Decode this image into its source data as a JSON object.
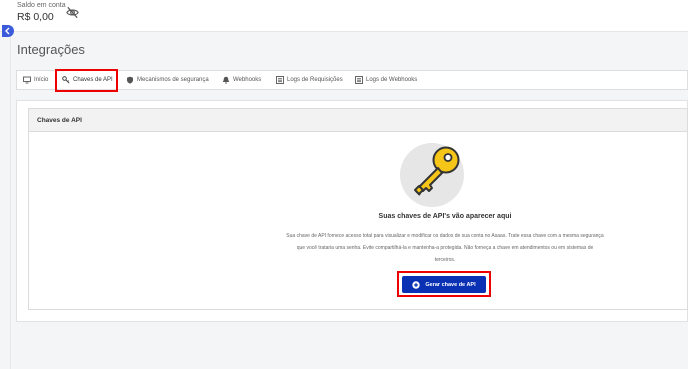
{
  "header": {
    "balance_label": "Saldo em conta",
    "balance_value": "R$ 0,00",
    "hide_balance_icon": "eye-slash-icon"
  },
  "sidebar": {
    "collapse_icon": "chevron-left-icon"
  },
  "page": {
    "title": "Integrações"
  },
  "tabs": [
    {
      "label": "Início",
      "icon": "monitor-icon"
    },
    {
      "label": "Chaves de API",
      "icon": "key-icon",
      "active": true
    },
    {
      "label": "Mecanismos de segurança",
      "icon": "shield-icon"
    },
    {
      "label": "Webhooks",
      "icon": "bell-icon"
    },
    {
      "label": "Logs de Requisições",
      "icon": "list-icon"
    },
    {
      "label": "Logs de Webhooks",
      "icon": "list-icon"
    }
  ],
  "card": {
    "title": "Chaves de API",
    "illustration": "key-icon",
    "empty_title": "Suas chaves de API's vão aparecer aqui",
    "empty_text": "Sua chave de API fornece acesso total para visualizar e modificar os dados de sua conta no Asaas. Trate essa chave com a mesma segurança que você trataria uma senha. Evite compartilhá-la e mantenha-a protegida. Não forneça a chave em atendimentos ou em sistemas de terceiros.",
    "generate_button": "Gerar chave de API",
    "generate_icon": "plus-circle-icon"
  },
  "colors": {
    "primary": "#0a30b4",
    "highlight": "#e00000",
    "key_yellow": "#f5c518",
    "illustration_bg": "#e6e6e6"
  }
}
